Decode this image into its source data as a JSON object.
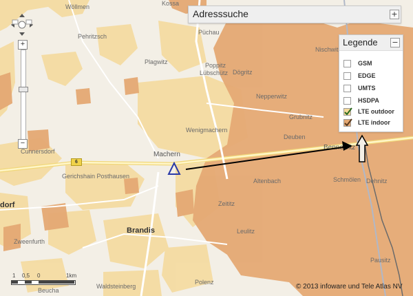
{
  "search": {
    "title": "Adresssuche",
    "toggle": "+"
  },
  "legend": {
    "title": "Legende",
    "toggle": "−",
    "items": [
      {
        "label": "GSM",
        "checked": false
      },
      {
        "label": "EDGE",
        "checked": false
      },
      {
        "label": "UMTS",
        "checked": false
      },
      {
        "label": "HSDPA",
        "checked": false
      },
      {
        "label": "LTE outdoor",
        "checked": true,
        "swatch": "#f5d99a"
      },
      {
        "label": "LTE indoor",
        "checked": true,
        "swatch": "#e5a974"
      }
    ]
  },
  "zoom": {
    "in": "+",
    "out": "−"
  },
  "places": {
    "woellmen": "Wöllmen",
    "kossa": "Kossa",
    "puechau": "Püchau",
    "pehritzsch": "Pehritzsch",
    "plagwitz": "Plagwitz",
    "poppitz": "Poppitz",
    "luebschuetz": "Lübschütz",
    "dogritz": "Dögritz",
    "nischwitz": "Nischwitz",
    "nepperwitz": "Nepperwitz",
    "grubnitz": "Grubnitz",
    "wenigmachern": "Wenigmachern",
    "deuben": "Deuben",
    "cunnersdorf": "Cunnersdorf",
    "machern": "Machern",
    "bennewitz": "Bennewitz",
    "gerichshain": "Gerichshain Posthausen",
    "altenbach": "Altenbach",
    "schmoelen": "Schmölen",
    "dehnitz": "Dehnitz",
    "zeititz": "Zeititz",
    "dorf": "dorf",
    "leulitz": "Leulitz",
    "brandis": "Brandis",
    "zweenfurth": "Zweenfurth",
    "waldsteinberg": "Waldsteinberg",
    "polenz": "Polenz",
    "beucha": "Beucha",
    "pausitz": "Pausitz",
    "road_number": "6"
  },
  "scale": {
    "t0": "1",
    "t1": "0,5",
    "t2": "0",
    "t3": "1km"
  },
  "copyright": "© 2013 infoware und Tele Atlas NV",
  "colors": {
    "lte_outdoor": "#f5d99a",
    "lte_indoor": "#e5a974",
    "marker": "#2a3aa8",
    "arrow": "#000000"
  },
  "icons": {
    "marker": "triangle-marker-icon",
    "arrow": "long-arrow-icon",
    "up_arrow": "up-arrow-icon"
  }
}
